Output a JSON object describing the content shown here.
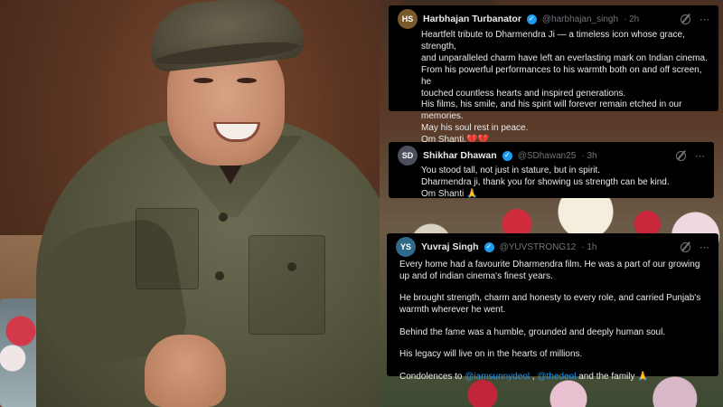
{
  "tweets": [
    {
      "name": "Harbhajan Turbanator",
      "handle": "@harbhajan_singh",
      "time": "· 2h",
      "avatar_initials": "HS",
      "avatar_color": "#7a5a2a",
      "lines": [
        "Heartfelt tribute to Dharmendra Ji — a timeless icon whose grace, strength,",
        "and unparalleled charm have left an everlasting mark on Indian cinema.",
        "From his powerful performances to his warmth both on and off screen, he",
        "touched countless hearts and inspired generations.",
        "His films, his smile, and his spirit will forever remain etched in our",
        "memories.",
        "May his soul rest in peace.",
        "Om Shanti.💔💔"
      ]
    },
    {
      "name": "Shikhar Dhawan",
      "handle": "@SDhawan25",
      "time": "· 3h",
      "avatar_initials": "SD",
      "avatar_color": "#4a4f5a",
      "lines": [
        "You stood tall, not just in stature, but in spirit.",
        "Dharmendra ji, thank you for showing us strength can be kind.",
        "Om Shanti 🙏"
      ]
    },
    {
      "name": "Yuvraj Singh",
      "handle": "@YUVSTRONG12",
      "time": "· 1h",
      "avatar_initials": "YS",
      "avatar_color": "#2f6a8a",
      "paragraphs": [
        "Every home had a favourite Dharmendra film. He was a part of our growing",
        "up and of indian cinema's finest years.",
        "He brought strength, charm and honesty to every role, and carried Punjab's",
        "warmth wherever he went.",
        "Behind the fame was a humble, grounded and deeply human soul.",
        "His legacy will live on in the hearts of millions."
      ],
      "condolence_prefix": "Condolences to ",
      "mention_1": "@iamsunnydeol",
      "separator": " , ",
      "mention_2": "@thedeol",
      "condolence_suffix": " and the family 🙏"
    }
  ],
  "icons": {
    "verified": "✓",
    "more": "⋯"
  },
  "colors": {
    "card_bg": "#000000",
    "text": "#e7e9ea",
    "muted": "#71767b",
    "link": "#1d9bf0"
  }
}
